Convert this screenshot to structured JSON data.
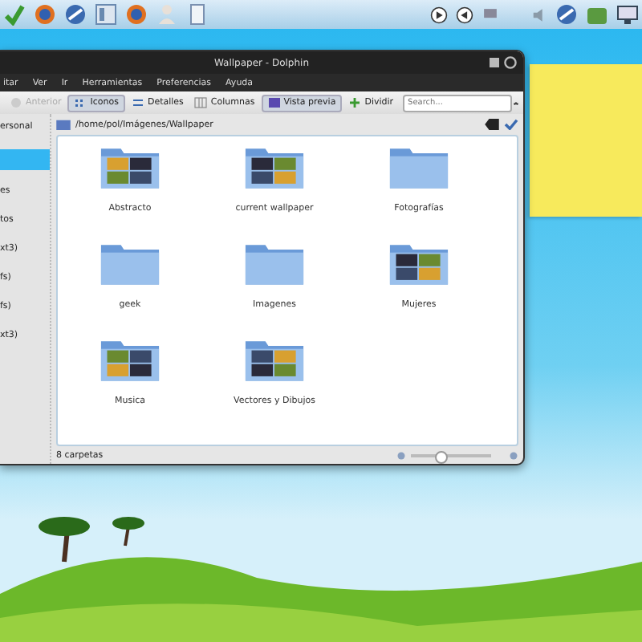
{
  "window": {
    "title": "Wallpaper - Dolphin"
  },
  "menu": [
    "itar",
    "Ver",
    "Ir",
    "Herramientas",
    "Preferencias",
    "Ayuda"
  ],
  "toolbar": [
    {
      "label": "Anterior",
      "kind": "back",
      "disabled": true,
      "selected": false
    },
    {
      "label": "Iconos",
      "kind": "icons",
      "disabled": false,
      "selected": true
    },
    {
      "label": "Detalles",
      "kind": "details",
      "disabled": false,
      "selected": false
    },
    {
      "label": "Columnas",
      "kind": "columns",
      "disabled": false,
      "selected": false
    },
    {
      "label": "Vista previa",
      "kind": "preview",
      "disabled": false,
      "selected": true
    },
    {
      "label": "Dividir",
      "kind": "split",
      "disabled": false,
      "selected": false
    }
  ],
  "search": {
    "placeholder": "Search..."
  },
  "location": "/home/pol/Imágenes/Wallpaper",
  "sidebar": {
    "items": [
      {
        "label": "ersonal",
        "selected": false
      },
      {
        "selected": true
      },
      {
        "label": "es",
        "selected": false
      },
      {
        "label": "tos",
        "selected": false
      },
      {
        "label": "xt3)",
        "selected": false
      },
      {
        "label": "fs)",
        "selected": false
      },
      {
        "label": "fs)",
        "selected": false
      },
      {
        "label": "xt3)",
        "selected": false
      }
    ]
  },
  "folders": [
    {
      "name": "Abstracto",
      "kind": "photos"
    },
    {
      "name": "current wallpaper",
      "kind": "photos"
    },
    {
      "name": "Fotografías",
      "kind": "plain"
    },
    {
      "name": "geek",
      "kind": "plain"
    },
    {
      "name": "Imagenes",
      "kind": "plain"
    },
    {
      "name": "Mujeres",
      "kind": "photos"
    },
    {
      "name": "Musica",
      "kind": "photos"
    },
    {
      "name": "Vectores y Dibujos",
      "kind": "photos"
    }
  ],
  "status_bar": {
    "text": "8 carpetas",
    "zoom": {
      "level": 0.35
    }
  }
}
